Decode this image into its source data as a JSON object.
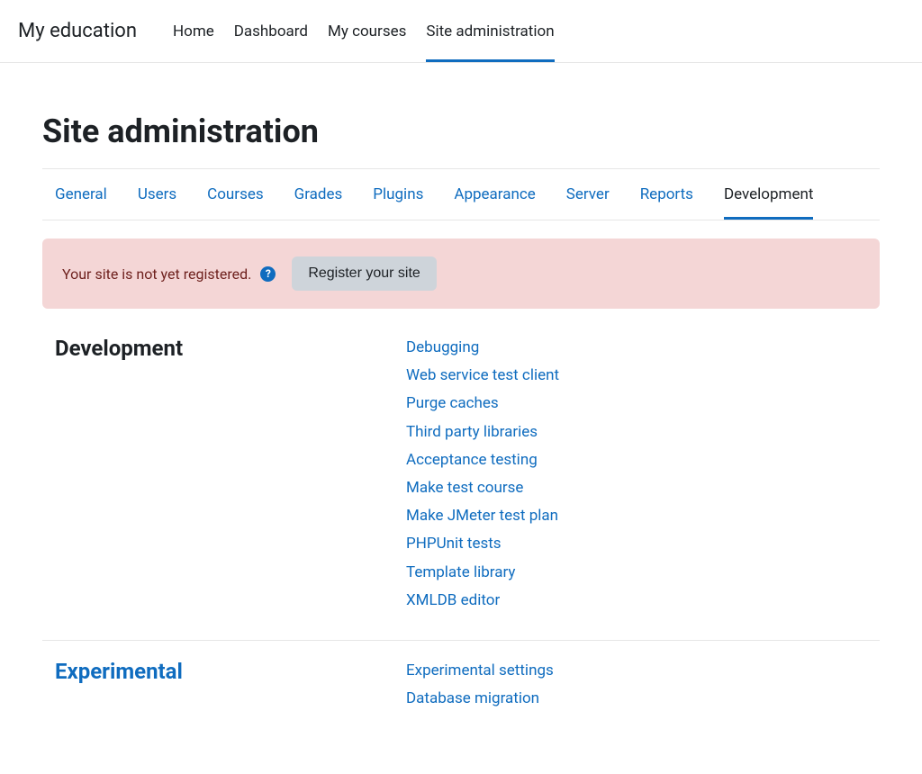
{
  "brand": "My education",
  "topnav": [
    {
      "label": "Home",
      "active": false
    },
    {
      "label": "Dashboard",
      "active": false
    },
    {
      "label": "My courses",
      "active": false
    },
    {
      "label": "Site administration",
      "active": true
    }
  ],
  "page_title": "Site administration",
  "subtabs": [
    {
      "label": "General",
      "active": false
    },
    {
      "label": "Users",
      "active": false
    },
    {
      "label": "Courses",
      "active": false
    },
    {
      "label": "Grades",
      "active": false
    },
    {
      "label": "Plugins",
      "active": false
    },
    {
      "label": "Appearance",
      "active": false
    },
    {
      "label": "Server",
      "active": false
    },
    {
      "label": "Reports",
      "active": false
    },
    {
      "label": "Development",
      "active": true
    }
  ],
  "alert": {
    "text": "Your site is not yet registered.",
    "help_glyph": "?",
    "button": "Register your site"
  },
  "sections": [
    {
      "title": "Development",
      "title_is_link": false,
      "links": [
        "Debugging",
        "Web service test client",
        "Purge caches",
        "Third party libraries",
        "Acceptance testing",
        "Make test course",
        "Make JMeter test plan",
        "PHPUnit tests",
        "Template library",
        "XMLDB editor"
      ]
    },
    {
      "title": "Experimental",
      "title_is_link": true,
      "links": [
        "Experimental settings",
        "Database migration"
      ]
    }
  ]
}
